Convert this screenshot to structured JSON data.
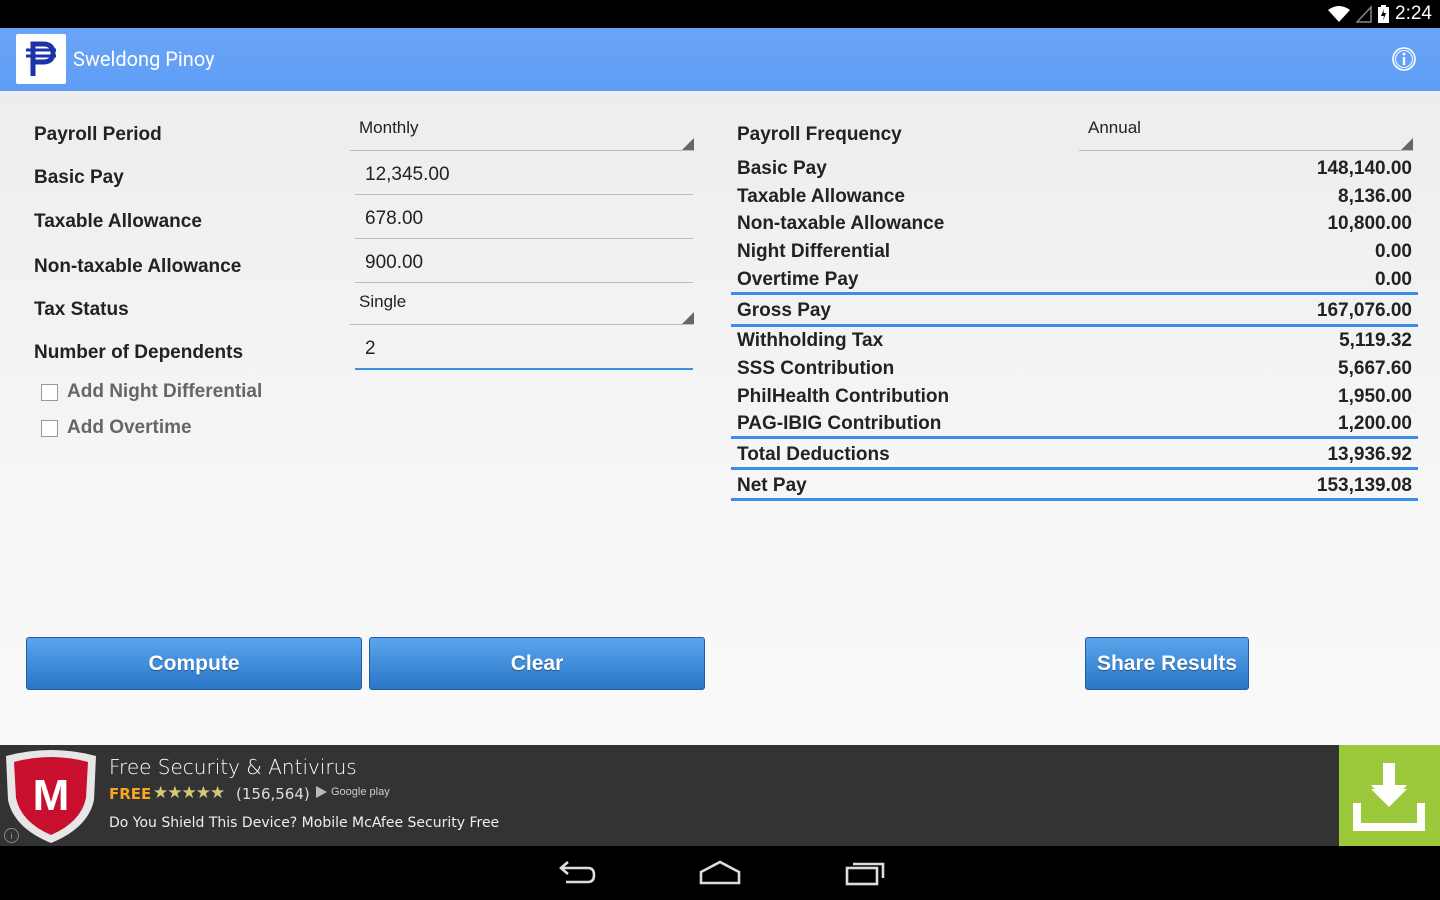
{
  "status_bar": {
    "time": "2:24"
  },
  "app": {
    "title": "Sweldong Pinoy",
    "icon": "peso-logo-icon"
  },
  "form": {
    "payroll_period": {
      "label": "Payroll Period",
      "value": "Monthly"
    },
    "basic_pay": {
      "label": "Basic Pay",
      "value": "12,345.00"
    },
    "taxable_allowance": {
      "label": "Taxable Allowance",
      "value": "678.00"
    },
    "non_taxable_allowance": {
      "label": "Non-taxable Allowance",
      "value": "900.00"
    },
    "tax_status": {
      "label": "Tax Status",
      "value": "Single"
    },
    "dependents": {
      "label": "Number of Dependents",
      "value": "2"
    },
    "night_diff": {
      "label": "Add Night Differential",
      "checked": false
    },
    "overtime": {
      "label": "Add Overtime",
      "checked": false
    }
  },
  "results": {
    "frequency": {
      "label": "Payroll Frequency",
      "value": "Annual"
    },
    "rows": [
      {
        "label": "Basic Pay",
        "value": "148,140.00"
      },
      {
        "label": "Taxable Allowance",
        "value": "8,136.00"
      },
      {
        "label": "Non-taxable Allowance",
        "value": "10,800.00"
      },
      {
        "label": "Night Differential",
        "value": "0.00"
      },
      {
        "label": "Overtime Pay",
        "value": "0.00"
      },
      {
        "label": "Gross Pay",
        "value": "167,076.00"
      },
      {
        "label": "Withholding Tax",
        "value": "5,119.32"
      },
      {
        "label": "SSS Contribution",
        "value": "5,667.60"
      },
      {
        "label": "PhilHealth Contribution",
        "value": "1,950.00"
      },
      {
        "label": "PAG-IBIG Contribution",
        "value": "1,200.00"
      },
      {
        "label": "Total Deductions",
        "value": "13,936.92"
      },
      {
        "label": "Net Pay",
        "value": "153,139.08"
      }
    ]
  },
  "buttons": {
    "compute": "Compute",
    "clear": "Clear",
    "share": "Share Results"
  },
  "ad": {
    "title": "Free Security & Antivirus",
    "price": "FREE",
    "stars": "★★★★★",
    "rating_count": "(156,564)",
    "store": "Google play",
    "description": "Do You Shield This Device? Mobile McAfee Security Free",
    "brand_letter": "M",
    "info": "i"
  },
  "colors": {
    "action_bar": "#6aa4f7",
    "accent": "#3a8ee6",
    "button": "#2a76c7",
    "ad_download": "#9cc83b"
  }
}
